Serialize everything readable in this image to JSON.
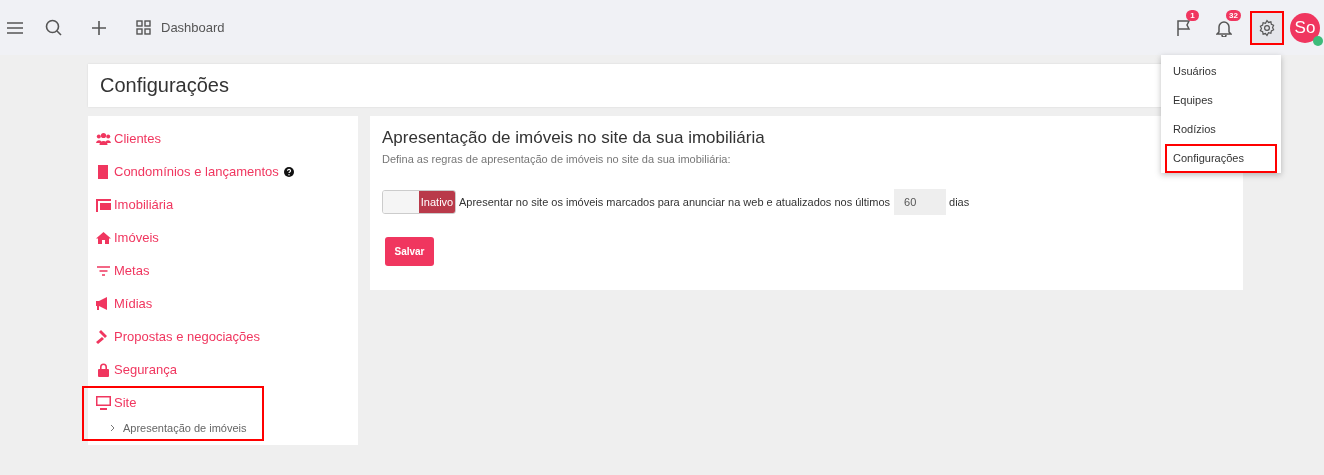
{
  "topbar": {
    "dashboard_label": "Dashboard",
    "flag_badge": "1",
    "bell_badge": "32",
    "settings_highlighted": true,
    "avatar_initials": "So",
    "avatar_online": true
  },
  "settings_menu": [
    {
      "label": "Usuários",
      "highlighted": false
    },
    {
      "label": "Equipes",
      "highlighted": false
    },
    {
      "label": "Rodízios",
      "highlighted": false
    },
    {
      "label": "Configurações",
      "highlighted": true
    }
  ],
  "page_title": "Configurações",
  "sidebar": {
    "items": [
      {
        "label": "Clientes",
        "help": false,
        "highlighted": false
      },
      {
        "label": "Condomínios e lançamentos",
        "help": true,
        "highlighted": false
      },
      {
        "label": "Imobiliária",
        "help": false,
        "highlighted": false
      },
      {
        "label": "Imóveis",
        "help": false,
        "highlighted": false
      },
      {
        "label": "Metas",
        "help": false,
        "highlighted": false
      },
      {
        "label": "Mídias",
        "help": false,
        "highlighted": false
      },
      {
        "label": "Propostas e negociações",
        "help": false,
        "highlighted": false
      },
      {
        "label": "Segurança",
        "help": false,
        "highlighted": false
      },
      {
        "label": "Site",
        "help": false,
        "highlighted": true,
        "children": [
          {
            "label": "Apresentação de imóveis"
          }
        ]
      }
    ]
  },
  "panel": {
    "title": "Apresentação de imóveis no site da sua imobiliária",
    "subtitle": "Defina as regras de apresentação de imóveis no site da sua imobiliária:",
    "toggle": {
      "on": false,
      "label": "Inativo"
    },
    "rule_text": "Apresentar no site os imóveis marcados para anunciar na web e atualizados nos últimos",
    "days_value": "60",
    "days_unit": "dias",
    "save_button": "Salvar"
  }
}
